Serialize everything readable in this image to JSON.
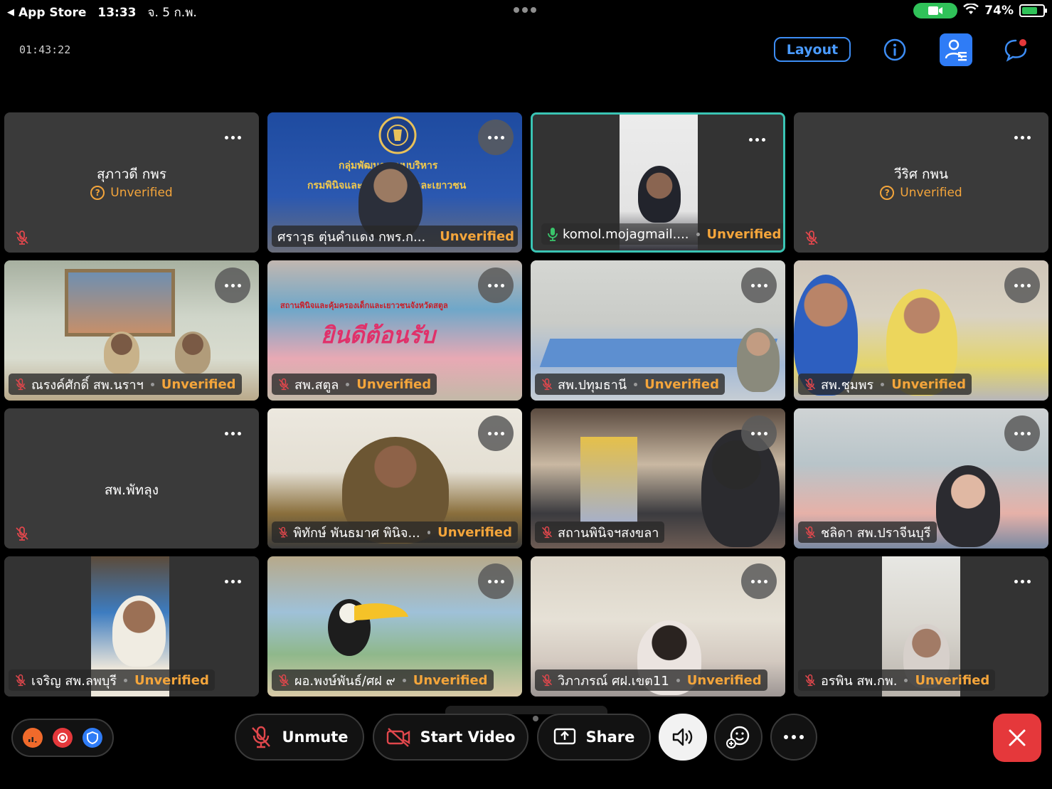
{
  "statusbar": {
    "back_app": "App Store",
    "time": "13:33",
    "date": "จ. 5 ก.พ.",
    "battery": "74%",
    "battery_level": 0.74
  },
  "topbar": {
    "timer": "01:43:22",
    "layout_label": "Layout",
    "icons": [
      "info-icon",
      "participants-icon",
      "chat-icon"
    ]
  },
  "tiles": [
    {
      "name": "สุภาวดี กพร",
      "status": "Unverified",
      "video": false
    },
    {
      "name": "ศราวุธ ตุ่นคำแดง กพร.ก...",
      "status": "Unverified",
      "video": true,
      "screen_text_1": "กลุ่มพัฒนาระบบบริหาร",
      "screen_text_2": "กรมพินิจและคุ้มครองเด็กและเยาวชน"
    },
    {
      "name": "komol.mojagmail....",
      "status": "Unverified",
      "video": true,
      "active_speaker": true
    },
    {
      "name": "วีริศ กพน",
      "status": "Unverified",
      "video": false
    },
    {
      "name": "ณรงค์ศักดิ์ สพ.นราฯ",
      "status": "Unverified",
      "video": true
    },
    {
      "name": "สพ.สตูล",
      "status": "Unverified",
      "video": true,
      "screen_text_1": "สถานพินิจและคุ้มครองเด็กและเยาวชนจังหวัดสตูล",
      "screen_text_2": "ยินดีต้อนรับ"
    },
    {
      "name": "สพ.ปทุมธานี",
      "status": "Unverified",
      "video": true
    },
    {
      "name": "สพ.ชุมพร",
      "status": "Unverified",
      "video": true
    },
    {
      "name": "สพ.พัทลุง",
      "status": "",
      "video": false
    },
    {
      "name": "พิทักษ์ พันธมาศ พินิจ...",
      "status": "Unverified",
      "video": true
    },
    {
      "name": "สถานพินิจฯสงขลา",
      "status": "",
      "video": true
    },
    {
      "name": "ชลิดา สพ.ปราจีนบุรี",
      "status": "",
      "video": true
    },
    {
      "name": "เจริญ สพ.ลพบุรี",
      "status": "Unverified",
      "video": true
    },
    {
      "name": "ผอ.พงษ์พันธ์/ศฝ ๙",
      "status": "Unverified",
      "video": true
    },
    {
      "name": "วิภาภรณ์ ศฝ.เขต11",
      "status": "Unverified",
      "video": true
    },
    {
      "name": "อรพิน สพ.กพ.",
      "status": "Unverified",
      "video": true
    }
  ],
  "controls": {
    "unmute_label": "Unmute",
    "start_video_label": "Start Video",
    "share_label": "Share"
  },
  "colors": {
    "accent_blue": "#2f7cf6",
    "unverified_orange": "#f4a53b",
    "active_border": "#3ac4b4",
    "leave_red": "#e5383b",
    "mute_red": "#e0474c"
  }
}
